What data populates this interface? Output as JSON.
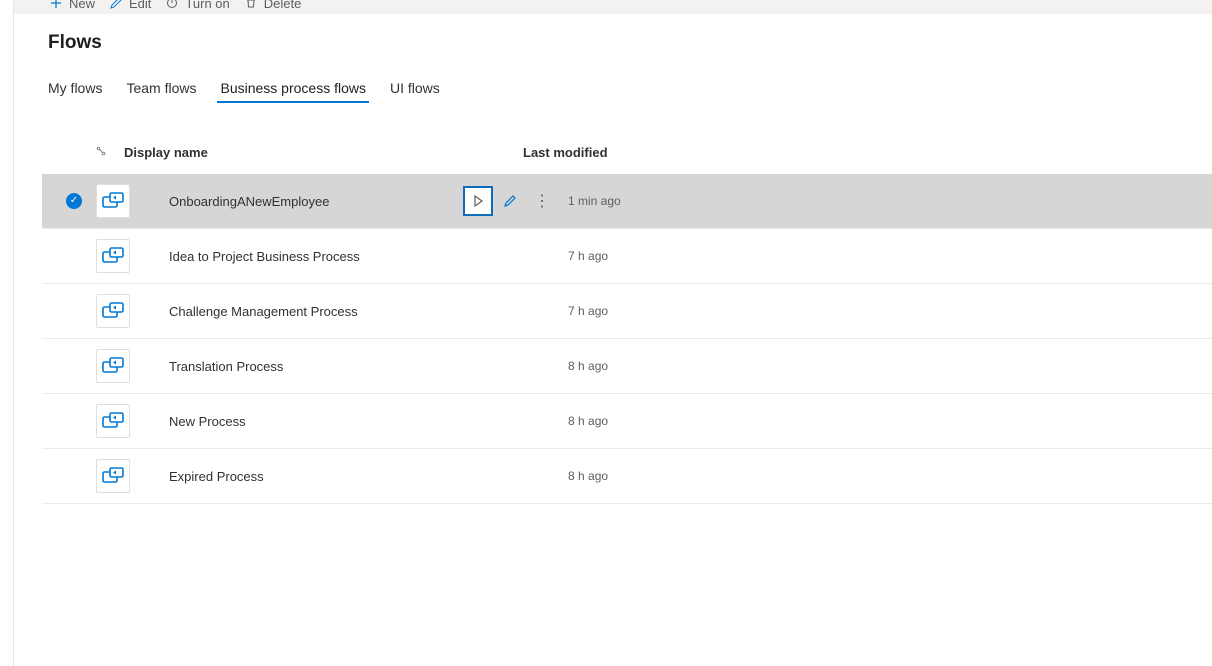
{
  "toolbar": {
    "new_label": "New",
    "edit_label": "Edit",
    "turn_on_label": "Turn on",
    "delete_label": "Delete"
  },
  "page_title": "Flows",
  "tabs": {
    "my_flows": "My flows",
    "team_flows": "Team flows",
    "business_process_flows": "Business process flows",
    "ui_flows": "UI flows"
  },
  "table": {
    "header": {
      "display_name": "Display name",
      "last_modified": "Last modified"
    },
    "rows": [
      {
        "name": "OnboardingANewEmployee",
        "modified": "1 min ago",
        "selected": true
      },
      {
        "name": "Idea to Project Business Process",
        "modified": "7 h ago",
        "selected": false
      },
      {
        "name": "Challenge Management Process",
        "modified": "7 h ago",
        "selected": false
      },
      {
        "name": "Translation Process",
        "modified": "8 h ago",
        "selected": false
      },
      {
        "name": "New Process",
        "modified": "8 h ago",
        "selected": false
      },
      {
        "name": "Expired Process",
        "modified": "8 h ago",
        "selected": false
      }
    ]
  }
}
